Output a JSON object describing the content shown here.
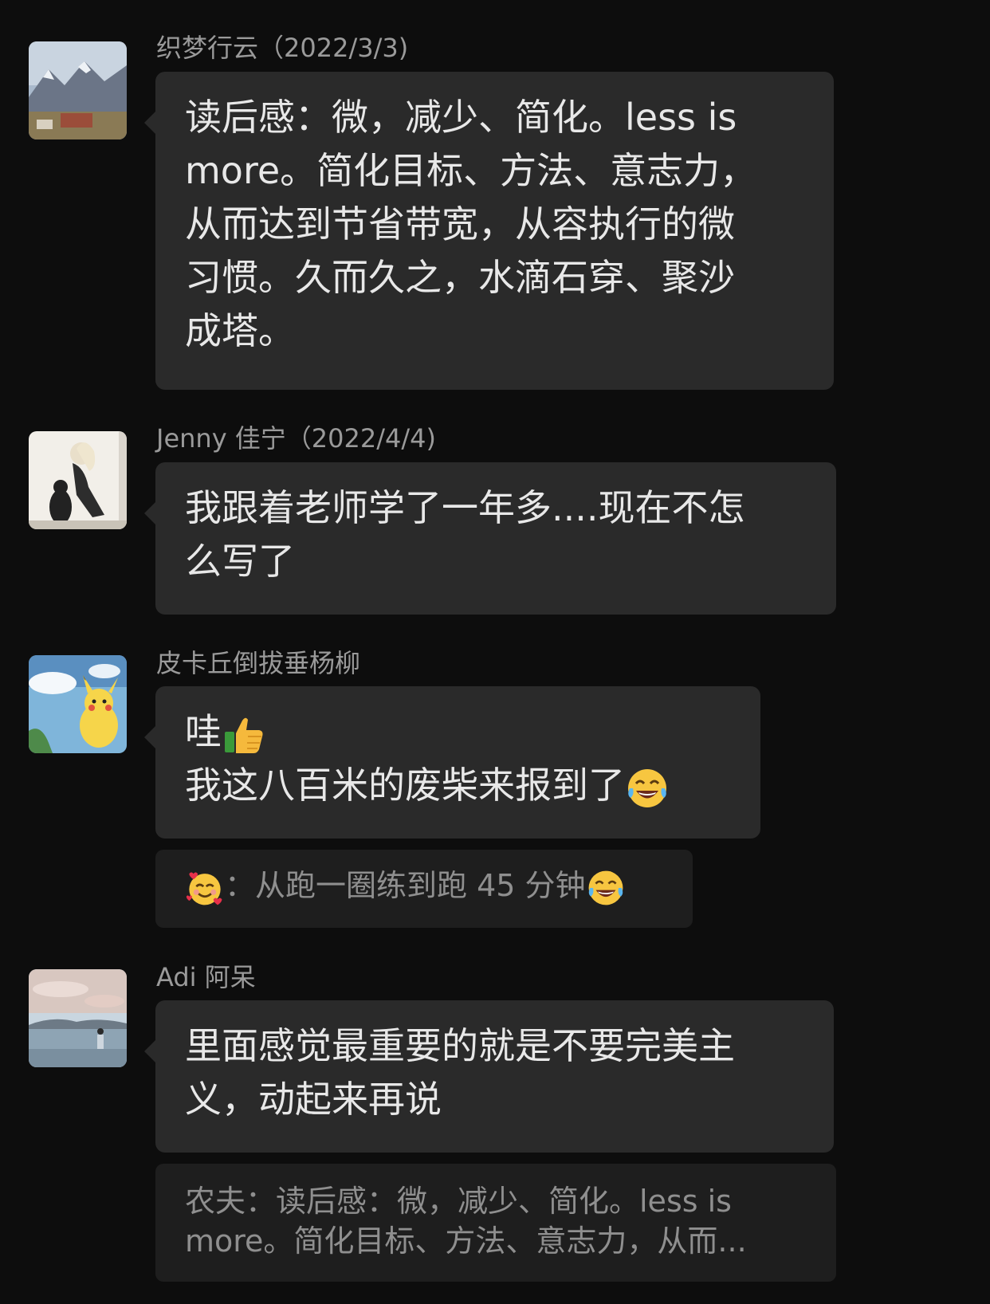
{
  "messages": [
    {
      "name": "织梦行云（2022/3/3)",
      "lines": [
        "读后感：微，减少、简化。less is",
        "more。简化目标、方法、意志力，",
        "从而达到节省带宽，从容执行的微",
        "习惯。久而久之，水滴石穿、聚沙",
        "成塔。"
      ]
    },
    {
      "name": "Jenny 佳宁（2022/4/4)",
      "lines": [
        "我跟着老师学了一年多....现在不怎",
        "么写了"
      ]
    },
    {
      "name": "皮卡丘倒拔垂杨柳",
      "lines": [
        "哇",
        "我这八百米的废柴来报到了"
      ],
      "emojis": [
        "thumbs-up-icon",
        "tears-of-joy-icon"
      ],
      "quote": {
        "emoji": "smiling-face-with-hearts-icon",
        "text": "：从跑一圈练到跑 45 分钟",
        "end_emoji": "tears-of-joy-icon"
      }
    },
    {
      "name": "Adi 阿呆",
      "lines": [
        "里面感觉最重要的就是不要完美主",
        "义，动起来再说"
      ],
      "quote": {
        "lines": [
          "农夫：读后感：微，减少、简化。less is",
          "more。简化目标、方法、意志力，从而..."
        ]
      }
    }
  ],
  "colors": {
    "background": "#0d0d0d",
    "bubble": "#2a2a2a",
    "quote_bubble": "#1e1e1e",
    "name_text": "#9a9a9a",
    "message_text": "#e8e8e8"
  }
}
